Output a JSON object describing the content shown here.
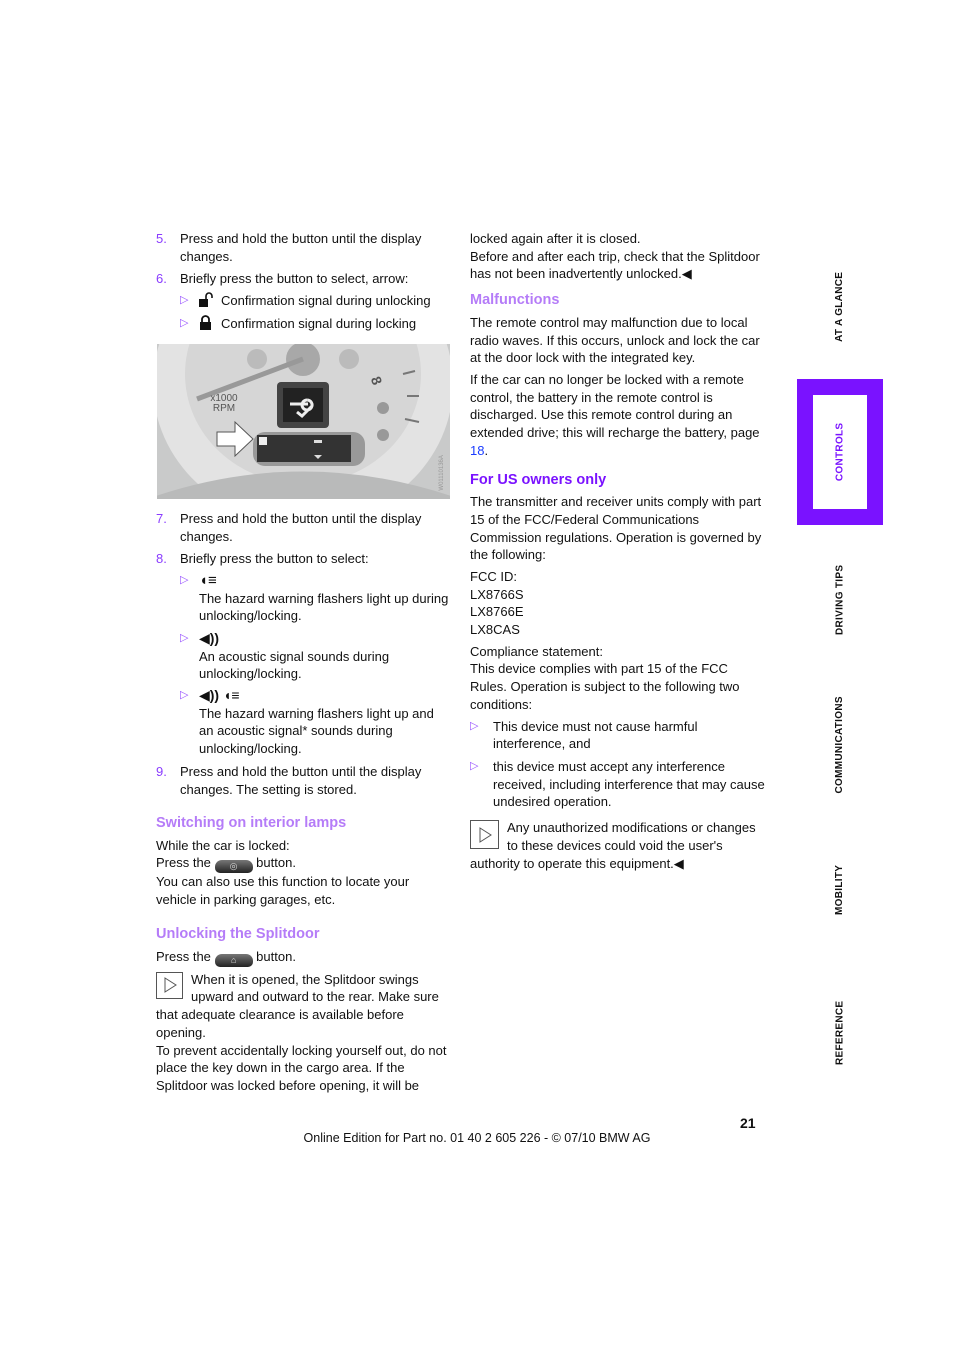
{
  "left": {
    "item5": {
      "num": "5.",
      "text": "Press and hold the button until the display changes."
    },
    "item6": {
      "num": "6.",
      "text": "Briefly press the button to select, arrow:",
      "subs": [
        "Confirmation signal during unlocking",
        "Confirmation signal during locking"
      ]
    },
    "figure": {
      "rpm_label": "x1000 RPM",
      "tach_8": "8",
      "code": "W01110136A"
    },
    "item7": {
      "num": "7.",
      "text": "Press and hold the button until the display changes."
    },
    "item8": {
      "num": "8.",
      "text": "Briefly press the button to select:",
      "subs": [
        "The hazard warning flashers light up during unlocking/locking.",
        "An acoustic signal sounds during unlocking/locking.",
        "The hazard warning flashers light up and an acoustic signal* sounds during unlocking/locking."
      ]
    },
    "item9": {
      "num": "9.",
      "text": "Press and hold the button until the display changes. The setting is stored."
    },
    "interior": {
      "heading": "Switching on interior lamps",
      "l1": "While the car is locked:",
      "press": "Press the",
      "button": "button.",
      "l3": "You can also use this function to locate your vehicle in parking garages, etc."
    },
    "splitdoor": {
      "heading": "Unlocking the Splitdoor",
      "press": "Press the",
      "button": "button.",
      "note": "When it is opened, the Splitdoor swings upward and outward to the rear. Make sure that adequate clearance is available before opening.",
      "p2": "To prevent accidentally locking yourself out, do not place the key down in the cargo area. If the Splitdoor was locked before opening, it will be"
    }
  },
  "right": {
    "cont": "locked again after it is closed.",
    "cont2": "Before and after each trip, check that the Splitdoor has not been inadvertently unlocked.◀",
    "malfunctions": {
      "heading": "Malfunctions",
      "p1": "The remote control may malfunction due to local radio waves. If this occurs, unlock and lock the car at the door lock with the integrated key.",
      "p2": "If the car can no longer be locked with a remote control, the battery in the remote control is discharged. Use this remote control during an extended drive; this will recharge the battery, page",
      "page_link": "18",
      "p2_end": "."
    },
    "us": {
      "heading": "For US owners only",
      "p1": "The transmitter and receiver units comply with part 15 of the FCC/Federal Communications Commission regulations. Operation is governed by the following:",
      "fcc": [
        "FCC ID:",
        "LX8766S",
        "LX8766E",
        "LX8CAS"
      ],
      "compliance": "Compliance statement:",
      "compliance_text": "This device complies with part 15 of the FCC Rules. Operation is subject to the following two conditions:",
      "bullets": [
        "This device must not cause harmful interference, and",
        "this device must accept any interference received, including interference that may cause undesired operation."
      ],
      "note": "Any unauthorized modifications or changes to these devices could void the user's authority to operate this equipment.◀"
    }
  },
  "tabs": [
    "AT A GLANCE",
    "CONTROLS",
    "DRIVING TIPS",
    "COMMUNICATIONS",
    "MOBILITY",
    "REFERENCE"
  ],
  "active_tab": "CONTROLS",
  "page_number": "21",
  "footer": "Online Edition for Part no. 01 40 2 605 226 - © 07/10  BMW AG",
  "colors": {
    "accent": "#7a12ff",
    "heading": "#b57cf8",
    "link": "#1a3cff"
  }
}
